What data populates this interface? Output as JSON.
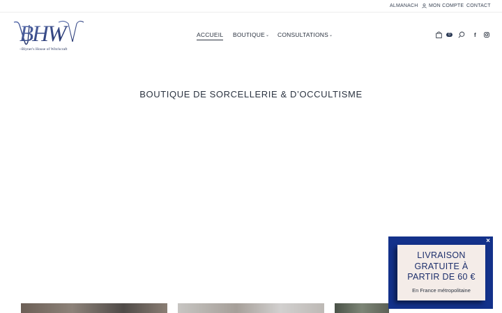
{
  "topbar": {
    "almanach": "ALMANACH",
    "account": "MON COMPTE",
    "contact": "CONTACT"
  },
  "logo": {
    "tagline": "~Blyner's House of Witchcraft"
  },
  "nav": {
    "items": [
      {
        "label": "ACCUEIL",
        "active": true
      },
      {
        "label": "BOUTIQUE",
        "has_dropdown": true
      },
      {
        "label": "CONSULTATIONS",
        "has_dropdown": true
      }
    ]
  },
  "header_icons": {
    "cart_count": "0",
    "facebook": "f"
  },
  "hero": {
    "title": "BOUTIQUE DE SORCELLERIE & D’OCCULTISME"
  },
  "promo": {
    "title_line1": "LIVRAISON",
    "title_line2": "GRATUITE À",
    "title_line3": "PARTIR DE 60 €",
    "subtitle": "En France métropolitaine",
    "close": "×"
  },
  "colors": {
    "text": "#2b3340",
    "accent": "#13318a",
    "promo_bg": "#f4ece8"
  }
}
